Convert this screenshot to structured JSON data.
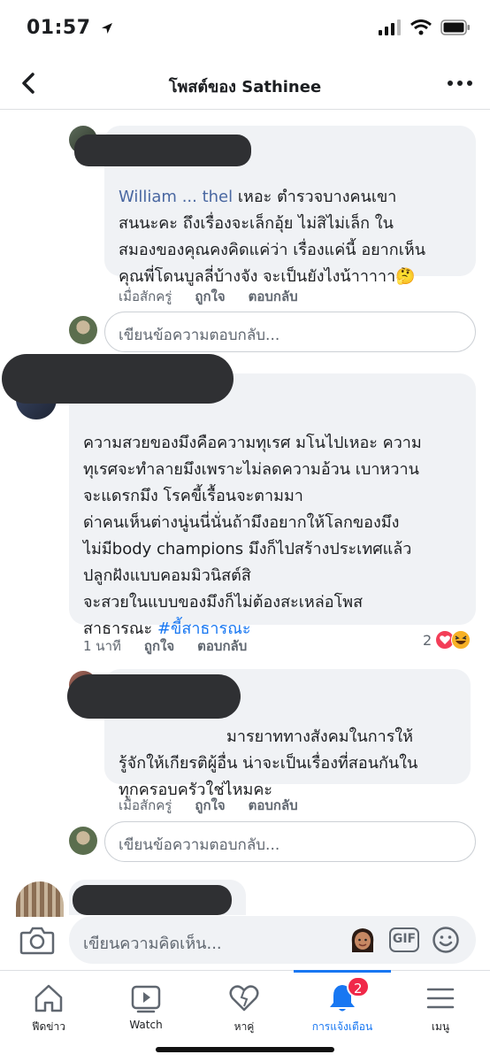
{
  "status_bar": {
    "time": "01:57"
  },
  "header": {
    "title": "โพสต์ของ Sathinee"
  },
  "comments": [
    {
      "author_partial": "William ... thel",
      "text_after_author": " เหอะ ตำรวจบางคนเขา\nสนนะคะ ถึงเรื่องจะเล็กอุ้ย ไม่สิไม่เล็ก ใน\nสมองของคุณคงคิดแค่ว่า เรื่องแค่นี้ อยากเห็น\nคุณพี่โดนบูลลี่บ้างจัง จะเป็นยังไงน้าาาาา🤔",
      "time": "เมื่อสักครู่",
      "like_label": "ถูกใจ",
      "reply_label": "ตอบกลับ"
    },
    {
      "text": "ความสวยของมึงคือความทุเรศ มโนไปเหอะ ความ\nทุเรศจะทำลายมึงเพราะไม่ลดความอ้วน เบาหวาน\nจะแดรกมึง โรคขี้เรื้อนจะตามมา\nด่าคนเห็นต่างนู่นนี่นั่นถ้ามึงอยากให้โลกของมึง\nไม่มีbody champions มึงก็ไปสร้างประเทศแล้ว\nปลูกฝังแบบคอมมิวนิสต์สิ\nจะสวยในแบบของมึงก็ไม่ต้องสะเหล่อโพส\nสาธารณะ ",
      "hashtag": "#ขี้สาธารณะ",
      "time": "1 นาที",
      "like_label": "ถูกใจ",
      "reply_label": "ตอบกลับ",
      "reaction_count": "2"
    },
    {
      "text": "มารยาททางสังคมในการให้\nรู้จักให้เกียรติผู้อื่น น่าจะเป็นเรื่องที่สอนกันใน\nทุกครอบครัวใช่ไหมคะ",
      "time": "เมื่อสักครู่",
      "like_label": "ถูกใจ",
      "reply_label": "ตอบกลับ"
    }
  ],
  "reply_placeholder": "เขียนข้อความตอบกลับ...",
  "compose": {
    "placeholder": "เขียนความคิดเห็น...",
    "gif_label": "GIF"
  },
  "tabs": [
    {
      "label": "ฟีดข่าว",
      "icon": "home-icon"
    },
    {
      "label": "Watch",
      "icon": "watch-icon"
    },
    {
      "label": "หาคู่",
      "icon": "dating-heart-icon"
    },
    {
      "label": "การแจ้งเตือน",
      "icon": "bell-icon",
      "badge": "2",
      "active": true
    },
    {
      "label": "เมนู",
      "icon": "menu-icon"
    }
  ],
  "colors": {
    "accent": "#1877f2",
    "link": "#385898",
    "bubble": "#f0f2f5",
    "badge": "#f02849"
  }
}
